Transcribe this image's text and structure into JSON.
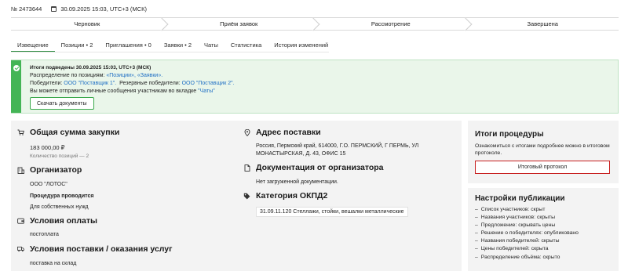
{
  "header": {
    "number": "№ 2473644",
    "datetime": "30.09.2025 15:03, UTC+3 (МСК)"
  },
  "steps": [
    "Черновик",
    "Приём заявок",
    "Рассмотрение",
    "Завершена"
  ],
  "tabs": [
    "Извещение",
    "Позиции • 2",
    "Приглашения • 0",
    "Заявки • 2",
    "Чаты",
    "Статистика",
    "История изменений"
  ],
  "banner": {
    "title": "Итоги подведены 30.09.2025 15:03, UTC+3 (МСК)",
    "line1_prefix": "Распределение по позициям: ",
    "line1_links": "«Позиции», «Заявки».",
    "line2_prefix": "Победители: ",
    "line2_winner": "ООО \"Поставщик 1\".",
    "line2_reserve_label": "  Резервные победители: ",
    "line2_reserve": "ООО \"Поставщик 2\".",
    "line3_prefix": "Вы можете отправить личные сообщения участникам во вкладке ",
    "line3_link": "\"Чаты\"",
    "download_label": "Скачать документы"
  },
  "main": {
    "sum_title": "Общая сумма закупки",
    "sum_value": "183 000,00 ₽",
    "sum_positions": "Количество позиций — 2",
    "org_title": "Организатор",
    "org_name": "ООО \"ЛОТОС\"",
    "org_proc_label": "Процедура проводится",
    "org_proc_value": "Для собственных нужд",
    "pay_title": "Условия оплаты",
    "pay_value": "постоплата",
    "delivery_title": "Условия поставки / оказания услуг",
    "delivery_value": "поставка на склад",
    "addr_title": "Адрес поставки",
    "addr_line1": "Россия, Пермский край, 614000, Г.О. ПЕРМСКИЙ, Г ПЕРМЬ, УЛ",
    "addr_line2": "МОНАСТЫРСКАЯ, Д. 43, ОФИС 15",
    "docs_title": "Документация от организатора",
    "docs_value": "Нет загруженной документации.",
    "okpd_title": "Категория ОКПД2",
    "okpd_value": "31.09.11.120 Стеллажи, стойки, вешалки металлические"
  },
  "results": {
    "title": "Итоги процедуры",
    "text": "Ознакомиться с итогами подробнее можно в итоговом протоколе.",
    "button": "Итоговый протокол"
  },
  "publication": {
    "title": "Настройки публикации",
    "items": [
      "Список участников: скрыт",
      "Названия участников: скрыты",
      "Предложение: скрывать цены",
      "Решение о победителях: опубликовано",
      "Названия победителей: скрыты",
      "Цены победителей: скрыта",
      "Распределение объёма: скрыто"
    ]
  }
}
